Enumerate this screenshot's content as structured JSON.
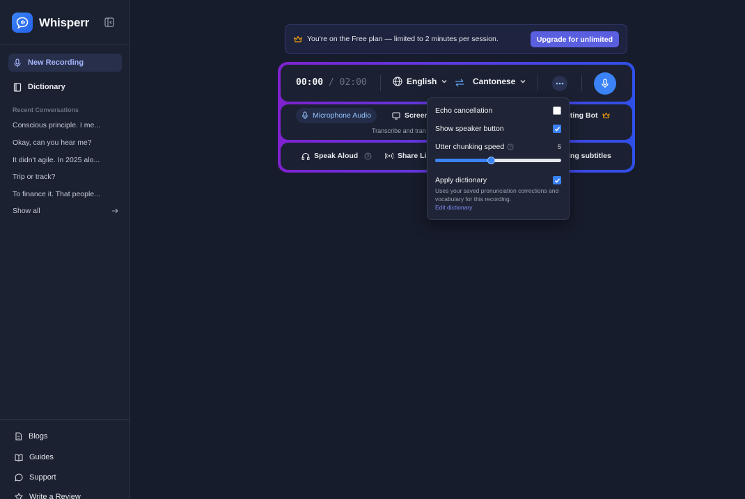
{
  "app": {
    "name": "Whisperr"
  },
  "sidebar": {
    "nav": [
      {
        "label": "New Recording",
        "icon": "mic-icon",
        "active": true
      },
      {
        "label": "Dictionary",
        "icon": "book-icon",
        "active": false
      }
    ],
    "recent_label": "Recent Conversations",
    "conversations": [
      "Conscious principle. I me...",
      "Okay, can you hear me?",
      "It didn't agile. In 2025 alo...",
      "Trip or track?",
      "To finance it. That people..."
    ],
    "show_all": "Show all",
    "footer": [
      {
        "label": "Blogs",
        "icon": "document-icon"
      },
      {
        "label": "Guides",
        "icon": "open-book-icon"
      },
      {
        "label": "Support",
        "icon": "chat-bubble-icon"
      },
      {
        "label": "Write a Review",
        "icon": "star-icon"
      }
    ]
  },
  "banner": {
    "text": "You're on the Free plan — limited to 2 minutes per session.",
    "cta": "Upgrade for unlimited",
    "icon": "crown-icon"
  },
  "controls": {
    "timer_elapsed": "00:00",
    "timer_sep": "/",
    "timer_limit": "02:00",
    "source_language": "English",
    "target_language": "Cantonese",
    "sources": [
      {
        "label": "Microphone Audio",
        "active": true
      },
      {
        "label": "Screen",
        "active": false
      },
      {
        "label": "eting Bot",
        "active": false
      }
    ],
    "hint": "Transcribe and tran",
    "options": [
      {
        "label": "Speak Aloud"
      },
      {
        "label": "Share Li"
      },
      {
        "label": "ing subtitles"
      }
    ]
  },
  "popover": {
    "echo_label": "Echo cancellation",
    "echo_checked": false,
    "speaker_label": "Show speaker button",
    "speaker_checked": true,
    "chunk_label": "Utter chunking speed",
    "chunk_value": "5",
    "chunk_fraction": 0.45,
    "dict_label": "Apply dictionary",
    "dict_checked": true,
    "dict_desc": "Uses your saved pronunciation corrections and vocabulary for this recording.",
    "dict_link": "Edit dictionary"
  },
  "colors": {
    "accent": "#3b82f6",
    "upgrade": "#5a5fe0",
    "crown": "#f59e0b"
  }
}
